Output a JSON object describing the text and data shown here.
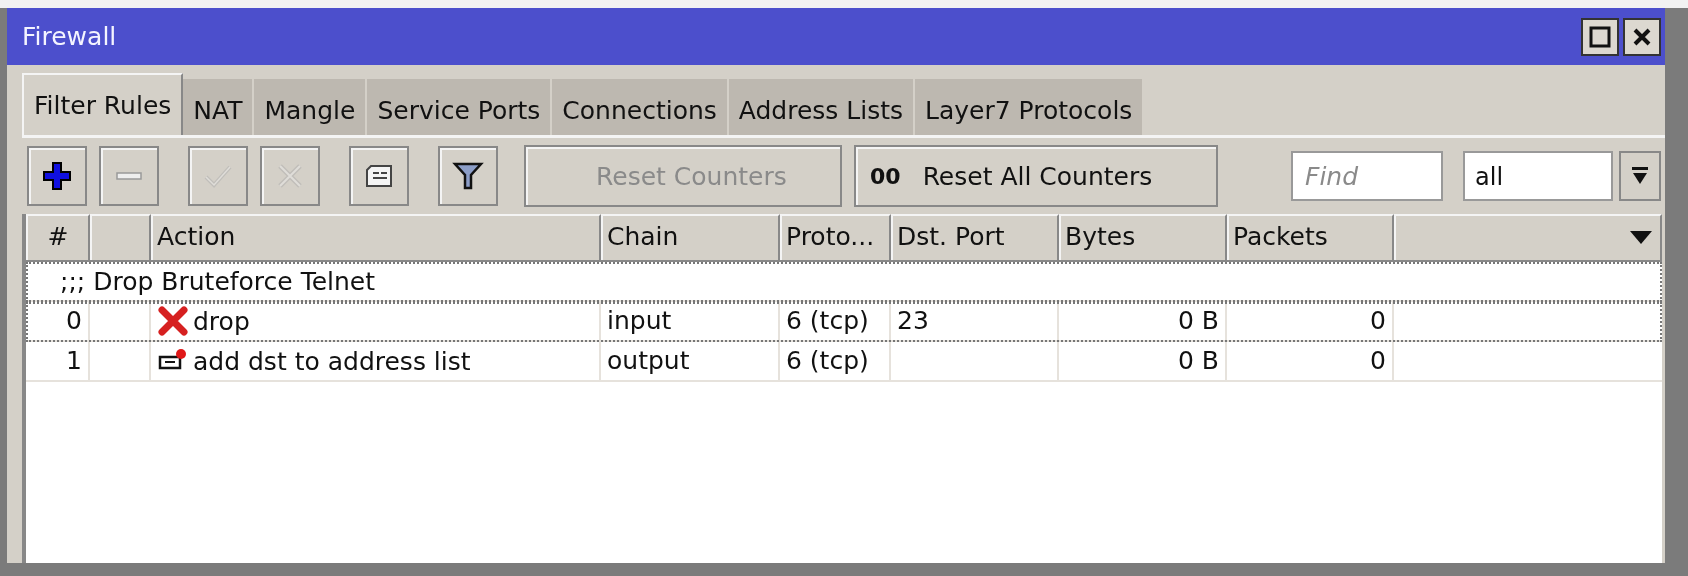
{
  "window": {
    "title": "Firewall"
  },
  "tabs": [
    {
      "label": "Filter Rules",
      "selected": true
    },
    {
      "label": "NAT",
      "selected": false
    },
    {
      "label": "Mangle",
      "selected": false
    },
    {
      "label": "Service Ports",
      "selected": false
    },
    {
      "label": "Connections",
      "selected": false
    },
    {
      "label": "Address Lists",
      "selected": false
    },
    {
      "label": "Layer7 Protocols",
      "selected": false
    }
  ],
  "toolbar": {
    "buttons": [
      {
        "kind": "add",
        "disabled": false
      },
      {
        "kind": "remove",
        "disabled": false
      },
      {
        "kind": "enable",
        "disabled": true
      },
      {
        "kind": "disable",
        "disabled": true
      },
      {
        "kind": "comment",
        "disabled": false
      },
      {
        "kind": "filter",
        "disabled": false
      }
    ],
    "reset_counters": {
      "label": "Reset Counters",
      "disabled": true
    },
    "reset_all_counters": {
      "glyph": "00",
      "label": "Reset All Counters",
      "disabled": false
    },
    "search": {
      "placeholder": "Find"
    },
    "scope": {
      "value": "all"
    }
  },
  "table": {
    "columns": [
      "#",
      "",
      "Action",
      "Chain",
      "Proto...",
      "Dst. Port",
      "Bytes",
      "Packets"
    ],
    "rows": [
      {
        "kind": "comment",
        "text": ";;; Drop Bruteforce Telnet",
        "focused": true
      },
      {
        "kind": "rule",
        "number": "0",
        "action": {
          "kind": "drop",
          "label": "drop"
        },
        "chain": "input",
        "protocol": "6 (tcp)",
        "dst_port": "23",
        "bytes": "0 B",
        "packets": "0",
        "focused": true
      },
      {
        "kind": "rule",
        "number": "1",
        "action": {
          "kind": "add-dst",
          "label": "add dst to address list"
        },
        "chain": "output",
        "protocol": "6 (tcp)",
        "dst_port": "",
        "bytes": "0 B",
        "packets": "0",
        "focused": false
      }
    ]
  }
}
